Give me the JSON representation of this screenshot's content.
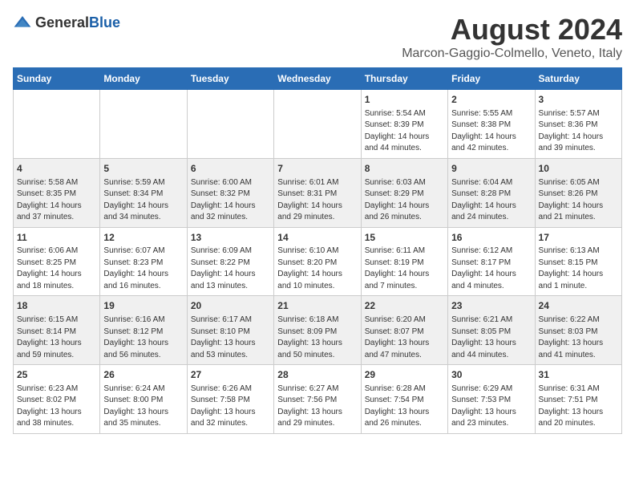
{
  "logo": {
    "general": "General",
    "blue": "Blue"
  },
  "title": "August 2024",
  "subtitle": "Marcon-Gaggio-Colmello, Veneto, Italy",
  "days": [
    "Sunday",
    "Monday",
    "Tuesday",
    "Wednesday",
    "Thursday",
    "Friday",
    "Saturday"
  ],
  "weeks": [
    [
      {
        "day": "",
        "content": ""
      },
      {
        "day": "",
        "content": ""
      },
      {
        "day": "",
        "content": ""
      },
      {
        "day": "",
        "content": ""
      },
      {
        "day": "1",
        "content": "Sunrise: 5:54 AM\nSunset: 8:39 PM\nDaylight: 14 hours\nand 44 minutes."
      },
      {
        "day": "2",
        "content": "Sunrise: 5:55 AM\nSunset: 8:38 PM\nDaylight: 14 hours\nand 42 minutes."
      },
      {
        "day": "3",
        "content": "Sunrise: 5:57 AM\nSunset: 8:36 PM\nDaylight: 14 hours\nand 39 minutes."
      }
    ],
    [
      {
        "day": "4",
        "content": "Sunrise: 5:58 AM\nSunset: 8:35 PM\nDaylight: 14 hours\nand 37 minutes."
      },
      {
        "day": "5",
        "content": "Sunrise: 5:59 AM\nSunset: 8:34 PM\nDaylight: 14 hours\nand 34 minutes."
      },
      {
        "day": "6",
        "content": "Sunrise: 6:00 AM\nSunset: 8:32 PM\nDaylight: 14 hours\nand 32 minutes."
      },
      {
        "day": "7",
        "content": "Sunrise: 6:01 AM\nSunset: 8:31 PM\nDaylight: 14 hours\nand 29 minutes."
      },
      {
        "day": "8",
        "content": "Sunrise: 6:03 AM\nSunset: 8:29 PM\nDaylight: 14 hours\nand 26 minutes."
      },
      {
        "day": "9",
        "content": "Sunrise: 6:04 AM\nSunset: 8:28 PM\nDaylight: 14 hours\nand 24 minutes."
      },
      {
        "day": "10",
        "content": "Sunrise: 6:05 AM\nSunset: 8:26 PM\nDaylight: 14 hours\nand 21 minutes."
      }
    ],
    [
      {
        "day": "11",
        "content": "Sunrise: 6:06 AM\nSunset: 8:25 PM\nDaylight: 14 hours\nand 18 minutes."
      },
      {
        "day": "12",
        "content": "Sunrise: 6:07 AM\nSunset: 8:23 PM\nDaylight: 14 hours\nand 16 minutes."
      },
      {
        "day": "13",
        "content": "Sunrise: 6:09 AM\nSunset: 8:22 PM\nDaylight: 14 hours\nand 13 minutes."
      },
      {
        "day": "14",
        "content": "Sunrise: 6:10 AM\nSunset: 8:20 PM\nDaylight: 14 hours\nand 10 minutes."
      },
      {
        "day": "15",
        "content": "Sunrise: 6:11 AM\nSunset: 8:19 PM\nDaylight: 14 hours\nand 7 minutes."
      },
      {
        "day": "16",
        "content": "Sunrise: 6:12 AM\nSunset: 8:17 PM\nDaylight: 14 hours\nand 4 minutes."
      },
      {
        "day": "17",
        "content": "Sunrise: 6:13 AM\nSunset: 8:15 PM\nDaylight: 14 hours\nand 1 minute."
      }
    ],
    [
      {
        "day": "18",
        "content": "Sunrise: 6:15 AM\nSunset: 8:14 PM\nDaylight: 13 hours\nand 59 minutes."
      },
      {
        "day": "19",
        "content": "Sunrise: 6:16 AM\nSunset: 8:12 PM\nDaylight: 13 hours\nand 56 minutes."
      },
      {
        "day": "20",
        "content": "Sunrise: 6:17 AM\nSunset: 8:10 PM\nDaylight: 13 hours\nand 53 minutes."
      },
      {
        "day": "21",
        "content": "Sunrise: 6:18 AM\nSunset: 8:09 PM\nDaylight: 13 hours\nand 50 minutes."
      },
      {
        "day": "22",
        "content": "Sunrise: 6:20 AM\nSunset: 8:07 PM\nDaylight: 13 hours\nand 47 minutes."
      },
      {
        "day": "23",
        "content": "Sunrise: 6:21 AM\nSunset: 8:05 PM\nDaylight: 13 hours\nand 44 minutes."
      },
      {
        "day": "24",
        "content": "Sunrise: 6:22 AM\nSunset: 8:03 PM\nDaylight: 13 hours\nand 41 minutes."
      }
    ],
    [
      {
        "day": "25",
        "content": "Sunrise: 6:23 AM\nSunset: 8:02 PM\nDaylight: 13 hours\nand 38 minutes."
      },
      {
        "day": "26",
        "content": "Sunrise: 6:24 AM\nSunset: 8:00 PM\nDaylight: 13 hours\nand 35 minutes."
      },
      {
        "day": "27",
        "content": "Sunrise: 6:26 AM\nSunset: 7:58 PM\nDaylight: 13 hours\nand 32 minutes."
      },
      {
        "day": "28",
        "content": "Sunrise: 6:27 AM\nSunset: 7:56 PM\nDaylight: 13 hours\nand 29 minutes."
      },
      {
        "day": "29",
        "content": "Sunrise: 6:28 AM\nSunset: 7:54 PM\nDaylight: 13 hours\nand 26 minutes."
      },
      {
        "day": "30",
        "content": "Sunrise: 6:29 AM\nSunset: 7:53 PM\nDaylight: 13 hours\nand 23 minutes."
      },
      {
        "day": "31",
        "content": "Sunrise: 6:31 AM\nSunset: 7:51 PM\nDaylight: 13 hours\nand 20 minutes."
      }
    ]
  ]
}
